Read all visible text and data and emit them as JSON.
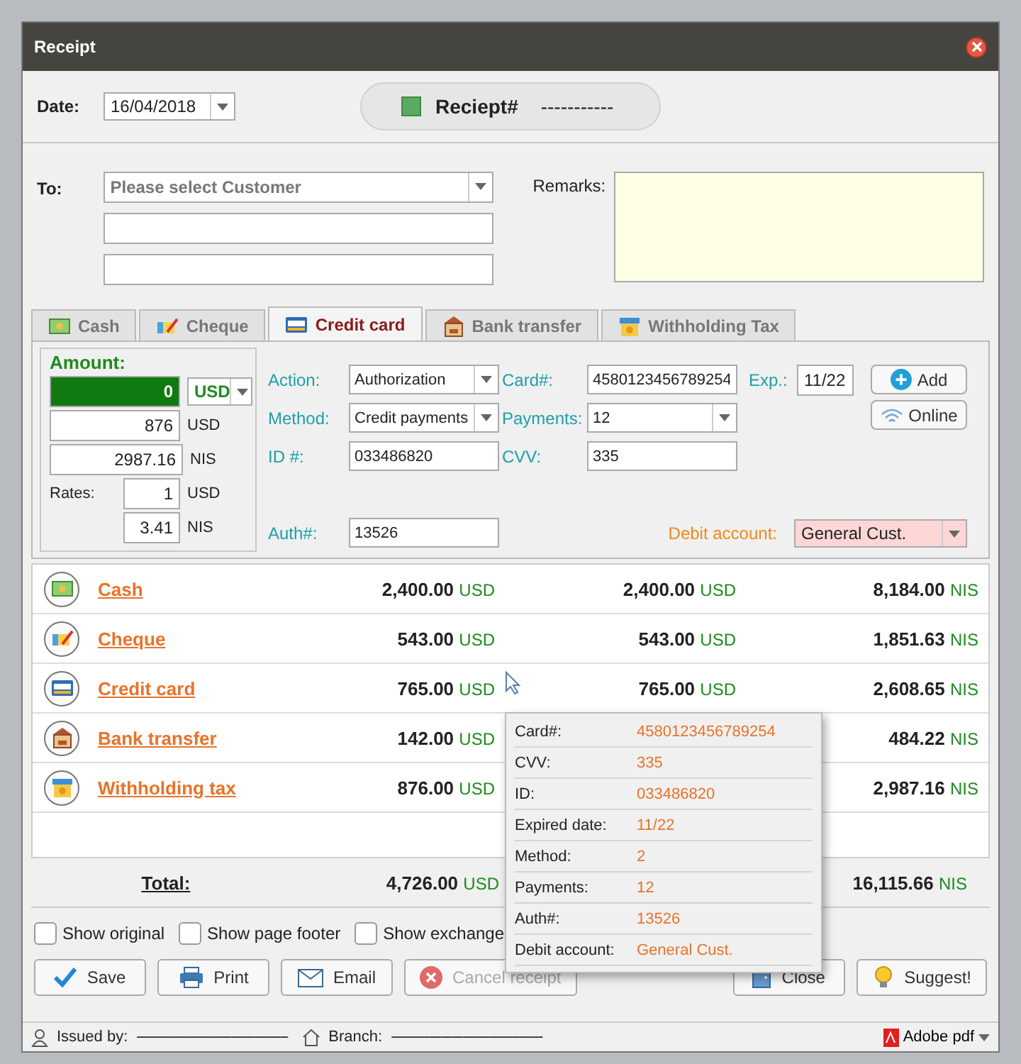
{
  "window": {
    "title": "Receipt"
  },
  "date": {
    "label": "Date:",
    "value": "16/04/2018"
  },
  "receipt_number": {
    "label": "Reciept#",
    "value": "-----------"
  },
  "customer": {
    "label": "To:",
    "placeholder": "Please select Customer"
  },
  "remarks": {
    "label": "Remarks:"
  },
  "tabs": [
    {
      "kind": "cash",
      "label": "Cash",
      "selected": false
    },
    {
      "kind": "cheque",
      "label": "Cheque",
      "selected": false
    },
    {
      "kind": "card",
      "label": "Credit card",
      "selected": true
    },
    {
      "kind": "bank",
      "label": "Bank transfer",
      "selected": false
    },
    {
      "kind": "tax",
      "label": "Withholding Tax",
      "selected": false
    }
  ],
  "amount": {
    "label": "Amount:",
    "value": "0",
    "currency": "USD",
    "usd_value": "876",
    "usd_unit": "USD",
    "nis_value": "2987.16",
    "nis_unit": "NIS",
    "rates_label": "Rates:",
    "rate_usd": "1",
    "rate_usd_unit": "USD",
    "rate_nis": "3.41",
    "rate_nis_unit": "NIS"
  },
  "card_form": {
    "action": {
      "label": "Action:",
      "value": "Authorization"
    },
    "method": {
      "label": "Method:",
      "value": "Credit payments"
    },
    "id": {
      "label": "ID #:",
      "value": "033486820"
    },
    "auth": {
      "label": "Auth#:",
      "value": "13526"
    },
    "card": {
      "label": "Card#:",
      "value": "4580123456789254"
    },
    "payments": {
      "label": "Payments:",
      "value": "12"
    },
    "cvv": {
      "label": "CVV:",
      "value": "335"
    },
    "exp": {
      "label": "Exp.:",
      "value": "11/22"
    },
    "debit": {
      "label": "Debit account:",
      "value": "General Cust."
    }
  },
  "side_buttons": [
    {
      "kind": "add",
      "label": "Add"
    },
    {
      "kind": "online",
      "label": "Online"
    }
  ],
  "payments": [
    {
      "kind": "cash",
      "name": "Cash",
      "amount": "2,400.00",
      "amount_currency": "USD",
      "amount2": "2,400.00",
      "amount2_currency": "USD",
      "nis": "8,184.00",
      "nis_currency": "NIS"
    },
    {
      "kind": "cheque",
      "name": "Cheque",
      "amount": "543.00",
      "amount_currency": "USD",
      "amount2": "543.00",
      "amount2_currency": "USD",
      "nis": "1,851.63",
      "nis_currency": "NIS"
    },
    {
      "kind": "card",
      "name": "Credit card",
      "amount": "765.00",
      "amount_currency": "USD",
      "amount2": "765.00",
      "amount2_currency": "USD",
      "nis": "2,608.65",
      "nis_currency": "NIS"
    },
    {
      "kind": "bank",
      "name": "Bank transfer",
      "amount": "142.00",
      "amount_currency": "USD",
      "nis": "484.22",
      "nis_currency": "NIS"
    },
    {
      "kind": "tax",
      "name": "Withholding tax",
      "amount": "876.00",
      "amount_currency": "USD",
      "nis": "2,987.16",
      "nis_currency": "NIS"
    }
  ],
  "total": {
    "label": "Total:",
    "amount": "4,726.00",
    "amount_currency": "USD",
    "nis": "16,115.66",
    "nis_currency": "NIS"
  },
  "options": [
    {
      "label": "Show original",
      "checked": false
    },
    {
      "label": "Show page footer",
      "checked": false
    },
    {
      "label": "Show exchange",
      "checked": false
    }
  ],
  "actions": [
    {
      "kind": "save",
      "label": "Save",
      "disabled": false
    },
    {
      "kind": "print",
      "label": "Print",
      "disabled": false
    },
    {
      "kind": "email",
      "label": "Email",
      "disabled": false
    },
    {
      "kind": "cancel",
      "label": "Cancel receipt",
      "disabled": true
    },
    {
      "kind": "close",
      "label": "Close",
      "disabled": false
    },
    {
      "kind": "suggest",
      "label": "Suggest!",
      "disabled": false
    }
  ],
  "tooltip": [
    {
      "label": "Card#:",
      "value": "4580123456789254"
    },
    {
      "label": "CVV:",
      "value": "335"
    },
    {
      "label": "ID:",
      "value": "033486820"
    },
    {
      "label": "Expired date:",
      "value": "11/22"
    },
    {
      "label": "Method:",
      "value": "2"
    },
    {
      "label": "Payments:",
      "value": "12"
    },
    {
      "label": "Auth#:",
      "value": "13526"
    },
    {
      "label": "Debit account:",
      "value": "General Cust."
    }
  ],
  "status_bar": {
    "issued_label": "Issued by:",
    "issued_value": "----------------------------------------",
    "branch_label": "Branch:",
    "branch_value": "----------------------------------------",
    "export": "Adobe pdf"
  }
}
